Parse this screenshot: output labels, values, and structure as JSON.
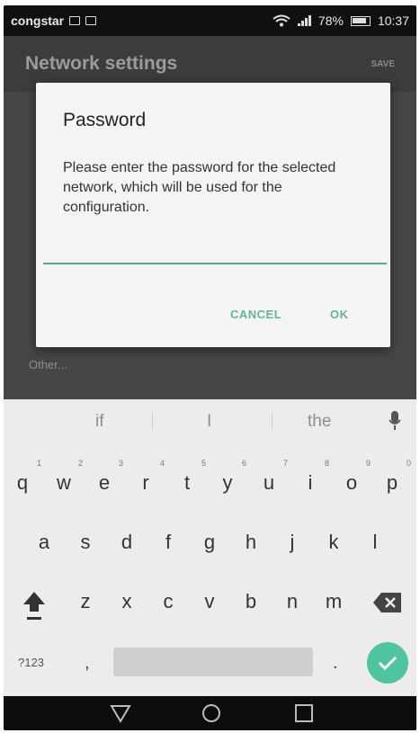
{
  "status_bar": {
    "carrier": "congstar",
    "battery": "78%",
    "time": "10:37"
  },
  "background_screen": {
    "title": "Network settings",
    "save_label": "SAVE",
    "other_label": "Other..."
  },
  "dialog": {
    "title": "Password",
    "message": "Please enter the password for the selected network, which will be used for the configuration.",
    "input_value": "",
    "cancel_label": "CANCEL",
    "ok_label": "OK"
  },
  "keyboard": {
    "suggestions": [
      "if",
      "I",
      "the"
    ],
    "row1": [
      {
        "key": "q",
        "hint": "1"
      },
      {
        "key": "w",
        "hint": "2"
      },
      {
        "key": "e",
        "hint": "3"
      },
      {
        "key": "r",
        "hint": "4"
      },
      {
        "key": "t",
        "hint": "5"
      },
      {
        "key": "y",
        "hint": "6"
      },
      {
        "key": "u",
        "hint": "7"
      },
      {
        "key": "i",
        "hint": "8"
      },
      {
        "key": "o",
        "hint": "9"
      },
      {
        "key": "p",
        "hint": "0"
      }
    ],
    "row2": [
      "a",
      "s",
      "d",
      "f",
      "g",
      "h",
      "j",
      "k",
      "l"
    ],
    "row3": [
      "z",
      "x",
      "c",
      "v",
      "b",
      "n",
      "m"
    ],
    "symbols_label": "?123",
    "comma": ",",
    "period": "."
  },
  "colors": {
    "accent": "#5fb3a3",
    "enter_key": "#4fc4a3",
    "input_underline": "#5aa79a"
  },
  "icons": [
    "wifi-icon",
    "signal-icon",
    "battery-icon",
    "mic-icon",
    "shift-icon",
    "backspace-icon",
    "check-icon",
    "back-icon",
    "home-icon",
    "recents-icon"
  ]
}
